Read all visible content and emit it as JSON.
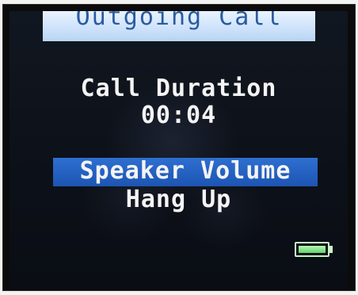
{
  "header": {
    "title": "Outgoing Call"
  },
  "call": {
    "duration_label": "Call Duration",
    "duration_value": "00:04"
  },
  "menu": {
    "items": [
      {
        "label": "Speaker Volume",
        "selected": true
      },
      {
        "label": "Hang Up",
        "selected": false
      }
    ]
  },
  "status": {
    "battery_level": 1.0,
    "battery_icon": "battery-icon"
  },
  "colors": {
    "title_bg": "#cfe3fb",
    "title_text": "#2a5b9e",
    "highlight": "#1d55b3",
    "screen_bg": "#0d1119",
    "text": "#f4f4f4",
    "battery": "#5fd56a"
  }
}
